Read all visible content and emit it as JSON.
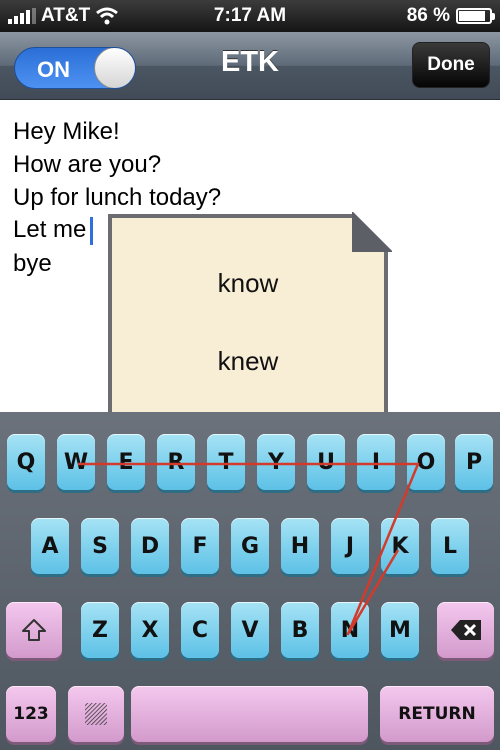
{
  "status_bar": {
    "carrier": "AT&T",
    "time": "7:17 AM",
    "battery": "86 %",
    "battery_level": 0.86
  },
  "nav": {
    "toggle_label": "ON",
    "title": "ETK",
    "done_label": "Done"
  },
  "text": {
    "lines": [
      "Hey Mike!",
      "How are you?",
      "Up for lunch today?",
      "Let me",
      "bye"
    ]
  },
  "suggestions": [
    "know",
    "knew"
  ],
  "keyboard": {
    "row1": [
      "Q",
      "W",
      "E",
      "R",
      "T",
      "Y",
      "U",
      "I",
      "O",
      "P"
    ],
    "row2": [
      "A",
      "S",
      "D",
      "F",
      "G",
      "H",
      "J",
      "K",
      "L"
    ],
    "row3": [
      "Z",
      "X",
      "C",
      "V",
      "B",
      "N",
      "M"
    ],
    "shift_icon": "shift-arrow-icon",
    "delete_icon": "backspace-icon",
    "numbers_label": "123",
    "pattern_icon": "hatch-pattern-icon",
    "return_label": "RETURN"
  },
  "colors": {
    "key_blue": "#7fd0ee",
    "key_pink": "#e6b4df",
    "swipe_line": "#d23b2b",
    "toggle_on": "#3b82e8",
    "cursor": "#2f6fe0"
  }
}
